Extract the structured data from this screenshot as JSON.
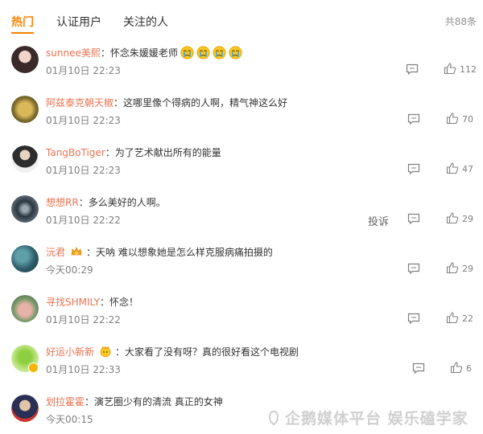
{
  "tabs": [
    {
      "label": "热门"
    },
    {
      "label": "认证用户"
    },
    {
      "label": "关注的人"
    }
  ],
  "total_label": "共88条",
  "report_label": "投诉",
  "separator": "：",
  "colors": {
    "accent": "#ff8200",
    "username": "#eb7350"
  },
  "comments": [
    {
      "username": "sunnee美熙",
      "text": "怀念朱媛媛老师",
      "emojis": [
        "crying-face-icon",
        "crying-face-icon",
        "crying-face-icon",
        "crying-face-icon"
      ],
      "time": "01月10日 22:23",
      "likes": "112"
    },
    {
      "username": "阿兹泰克朝天椒",
      "text": "这哪里像个得病的人啊，精气神这么好",
      "time": "01月10日 22:23",
      "likes": "70"
    },
    {
      "username": "TangBoTiger",
      "text": "为了艺术献出所有的能量",
      "time": "01月10日 22:23",
      "likes": "47"
    },
    {
      "username": "想想RR",
      "text": "多么美好的人啊。",
      "time": "01月10日 22:22",
      "likes": "29"
    },
    {
      "username": "沅君",
      "text": "天呐 难以想象她是怎么样克服病痛拍摄的",
      "time": "今天00:29",
      "likes": "29"
    },
    {
      "username": "寻找SHMILY",
      "text": "怀念！",
      "time": "01月10日 22:22",
      "likes": "22"
    },
    {
      "username": "好运小新新",
      "text": "大家看了没有呀？真的很好看这个电视剧",
      "time": "01月10日 22:33",
      "likes": "6"
    },
    {
      "username": "划拉霍霍",
      "text": "演艺圈少有的清流 真正的女神",
      "time": "今天00:15",
      "likes": ""
    }
  ],
  "watermark": "企鹅媒体平台 娱乐磕学家"
}
